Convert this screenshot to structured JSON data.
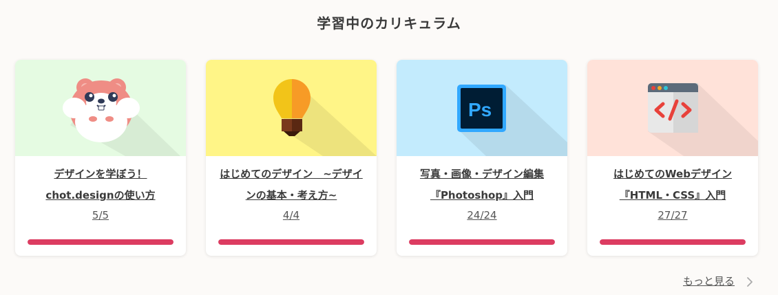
{
  "section": {
    "title": "学習中のカリキュラム"
  },
  "courses": [
    {
      "title_line1": "デザインを学ぼう！",
      "title_line2": "chot.designの使い方",
      "progress_text": "5/5",
      "progress_fraction": 1.0,
      "thumb_bg": "#e5fbe2",
      "icon": "hamster-icon"
    },
    {
      "title_line1": "はじめてのデザイン　~デザイ",
      "title_line2": "ンの基本・考え方~",
      "progress_text": "4/4",
      "progress_fraction": 1.0,
      "thumb_bg": "#fff587",
      "icon": "lightbulb-icon"
    },
    {
      "title_line1": "写真・画像・デザイン編集",
      "title_line2": "『Photoshop』入門",
      "progress_text": "24/24",
      "progress_fraction": 1.0,
      "thumb_bg": "#c3ebfd",
      "icon": "photoshop-icon"
    },
    {
      "title_line1": "はじめてのWebデザイン",
      "title_line2": "『HTML・CSS』入門",
      "progress_text": "27/27",
      "progress_fraction": 1.0,
      "thumb_bg": "#ffe2d9",
      "icon": "browser-code-icon"
    }
  ],
  "more": {
    "label": "もっと見る"
  },
  "colors": {
    "accent": "#dc3c61",
    "page_bg": "#fcfaf8"
  }
}
